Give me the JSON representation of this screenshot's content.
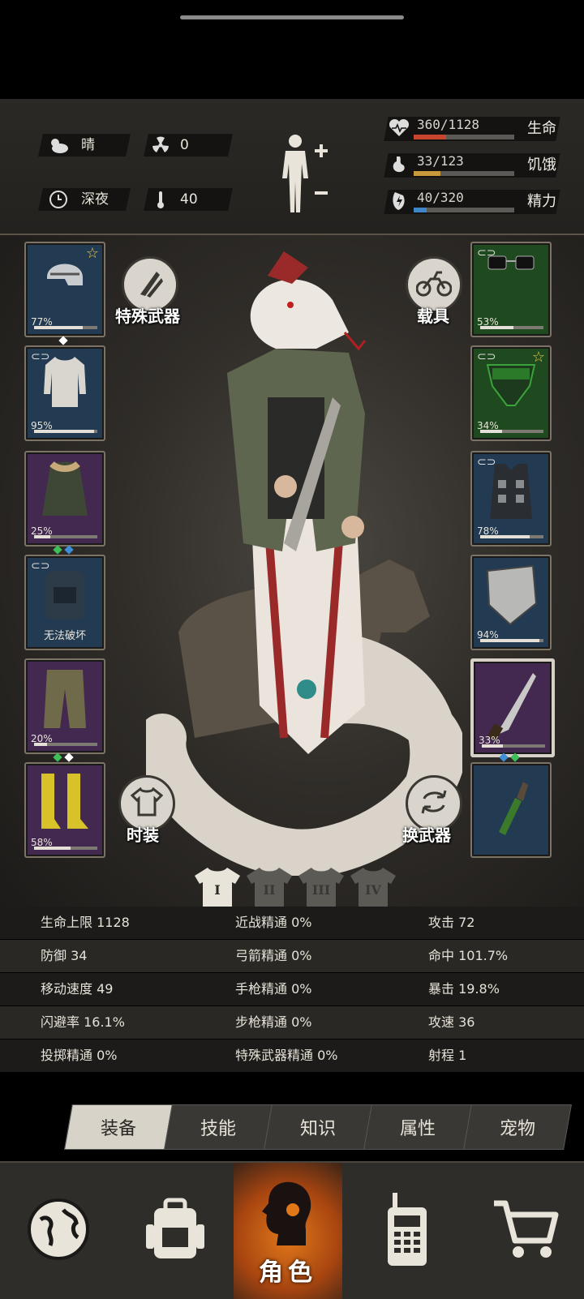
{
  "status": {
    "weather": "晴",
    "radiation": "0",
    "time_of_day": "深夜",
    "temperature": "40",
    "stats": [
      {
        "label": "生命",
        "value": "360/1128",
        "fraction": 0.319,
        "color": "#c8462e",
        "icon": "heart-pulse-icon"
      },
      {
        "label": "饥饿",
        "value": "33/123",
        "fraction": 0.268,
        "color": "#c89a3a",
        "icon": "stomach-icon"
      },
      {
        "label": "精力",
        "value": "40/320",
        "fraction": 0.125,
        "color": "#3f86c8",
        "icon": "energy-icon"
      }
    ]
  },
  "equipment": {
    "left": [
      {
        "name": "helmet",
        "pct": "77%",
        "durability": 0.77,
        "rarity": "blue",
        "star": true,
        "link": false,
        "gems": [
          "#ffffff"
        ]
      },
      {
        "name": "undershirt",
        "pct": "95%",
        "durability": 0.95,
        "rarity": "blue",
        "star": false,
        "link": true,
        "gems": []
      },
      {
        "name": "fur-coat",
        "pct": "25%",
        "durability": 0.25,
        "rarity": "purple",
        "star": false,
        "link": false,
        "gems": [
          "#3fbf5a",
          "#3f8fd8"
        ]
      },
      {
        "name": "backpack",
        "label": "无法破坏",
        "rarity": "blue",
        "star": false,
        "link": true,
        "gems": []
      },
      {
        "name": "pants",
        "pct": "20%",
        "durability": 0.2,
        "rarity": "purple",
        "star": false,
        "link": false,
        "gems": [
          "#3fbf5a",
          "#ffffff"
        ]
      },
      {
        "name": "boots",
        "pct": "58%",
        "durability": 0.58,
        "rarity": "purple",
        "star": false,
        "link": false,
        "gems": []
      }
    ],
    "right": [
      {
        "name": "glasses",
        "pct": "53%",
        "durability": 0.53,
        "rarity": "green",
        "star": false,
        "link": true,
        "gems": []
      },
      {
        "name": "gas-mask",
        "pct": "34%",
        "durability": 0.34,
        "rarity": "green",
        "star": true,
        "link": true,
        "gems": []
      },
      {
        "name": "vest",
        "pct": "78%",
        "durability": 0.78,
        "rarity": "blue",
        "star": false,
        "link": true,
        "gems": []
      },
      {
        "name": "shield",
        "pct": "94%",
        "durability": 0.94,
        "rarity": "blue",
        "star": false,
        "link": false,
        "gems": []
      },
      {
        "name": "machete",
        "pct": "33%",
        "durability": 0.33,
        "rarity": "purple",
        "star": false,
        "link": false,
        "selected": true,
        "gems": [
          "#3f8fd8",
          "#3fbf5a"
        ]
      },
      {
        "name": "molotov",
        "rarity": "blue",
        "star": false,
        "link": false,
        "gems": []
      }
    ],
    "special_weapon_label": "特殊武器",
    "vehicle_label": "载具",
    "outfit_label": "时装",
    "swap_weapon_label": "换武器",
    "outfit_tabs": [
      "I",
      "II",
      "III",
      "IV"
    ]
  },
  "stats_table": [
    [
      "生命上限 1128",
      "近战精通 0%",
      "攻击 72"
    ],
    [
      "防御 34",
      "弓箭精通 0%",
      "命中 101.7%"
    ],
    [
      "移动速度 49",
      "手枪精通 0%",
      "暴击 19.8%"
    ],
    [
      "闪避率 16.1%",
      "步枪精通 0%",
      "攻速 36"
    ],
    [
      "投掷精通 0%",
      "特殊武器精通 0%",
      "射程 1"
    ]
  ],
  "tabs": [
    "装备",
    "技能",
    "知识",
    "属性",
    "宠物"
  ],
  "active_tab": "装备",
  "nav": {
    "items": [
      "globe-icon",
      "backpack-icon",
      "character-icon",
      "radio-icon",
      "cart-icon"
    ],
    "active_label": "角色"
  }
}
